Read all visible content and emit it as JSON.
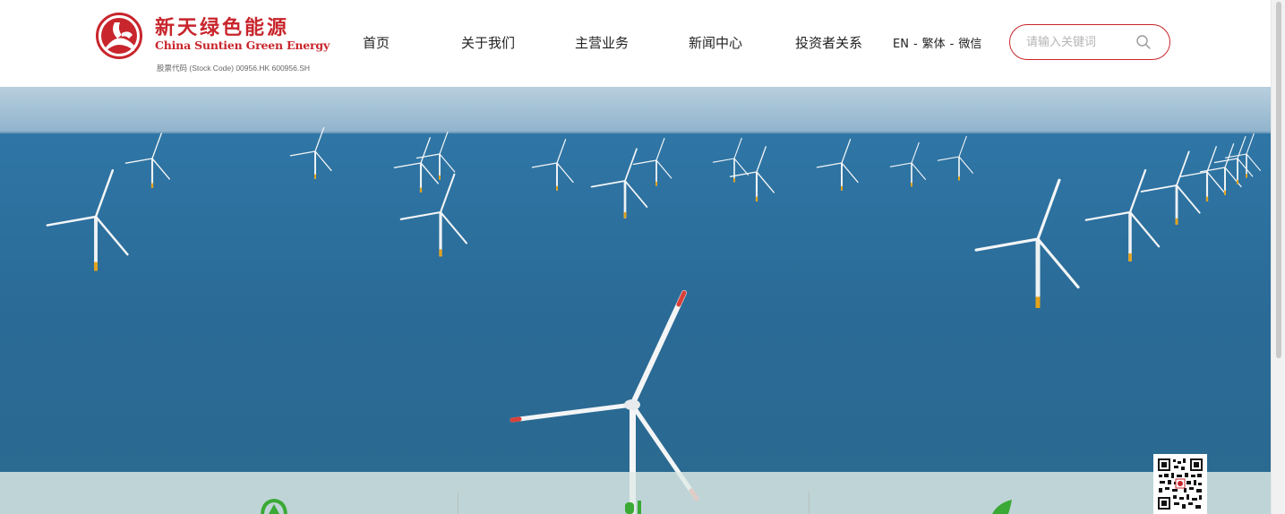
{
  "brand": {
    "name_cn": "新天绿色能源",
    "name_en": "China Suntien Green Energy",
    "stock_code": "股票代码 (Stock Code) 00956.HK 600956.SH",
    "color": "#c8252c"
  },
  "nav": {
    "items": [
      {
        "label": "首页"
      },
      {
        "label": "关于我们"
      },
      {
        "label": "主营业务"
      },
      {
        "label": "新闻中心"
      },
      {
        "label": "投资者关系"
      }
    ]
  },
  "lang": {
    "en": "EN",
    "sep": "-",
    "traditional": "繁体",
    "wechat": "微信"
  },
  "search": {
    "placeholder": "请输入关键词",
    "icon": "search-icon"
  },
  "hero": {
    "icons": [
      "leaf-icon",
      "plug-icon",
      "leaf-shape-icon"
    ],
    "sea_color": "#2b6f9e",
    "sky_color": "#a7c3d6"
  }
}
